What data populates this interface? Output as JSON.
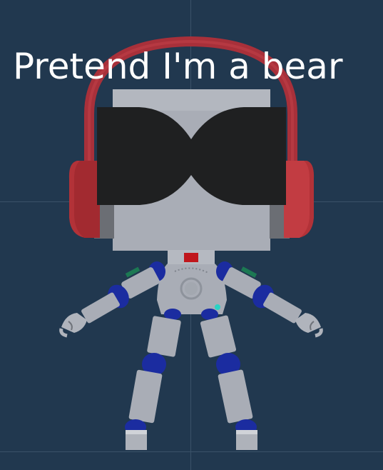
{
  "scene": {
    "caption": "Pretend I'm a bear",
    "colors": {
      "background": "#21384f",
      "grid": "#3a5268",
      "headphones": "#b0343a",
      "robot_body": "#a9adb6",
      "joint": "#1b2ca0",
      "glasses": "#1f2021",
      "chest_light": "#c0161c",
      "accent": "#2ad3c5"
    },
    "icons": [
      "robot-figure",
      "headphones-icon",
      "sunglasses-icon"
    ]
  }
}
